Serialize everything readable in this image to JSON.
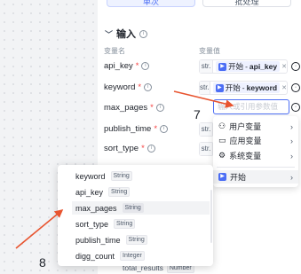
{
  "tabs": [
    {
      "label": "单次"
    },
    {
      "label": "批处理"
    }
  ],
  "section": {
    "title": "输入",
    "col_name": "变量名",
    "col_value": "变量值"
  },
  "rows": [
    {
      "name": "api_key",
      "required": "*",
      "type": "str.",
      "ref_prefix": "开始",
      "ref_var": "api_key"
    },
    {
      "name": "keyword",
      "required": "*",
      "type": "str.",
      "ref_prefix": "开始",
      "ref_var": "keyword"
    },
    {
      "name": "max_pages",
      "required": "*",
      "placeholder": "输入或引用参数值"
    },
    {
      "name": "publish_time",
      "required": "*",
      "type": "str."
    },
    {
      "name": "sort_type",
      "required": "*",
      "type": "str."
    }
  ],
  "ref_separator": "-",
  "dropdown": {
    "items": [
      {
        "label": "用户变量"
      },
      {
        "label": "应用变量"
      },
      {
        "label": "系统变量"
      },
      {
        "label": "开始"
      }
    ]
  },
  "variables": [
    {
      "name": "keyword",
      "type": "String"
    },
    {
      "name": "api_key",
      "type": "String"
    },
    {
      "name": "max_pages",
      "type": "String"
    },
    {
      "name": "sort_type",
      "type": "String"
    },
    {
      "name": "publish_time",
      "type": "String"
    },
    {
      "name": "digg_count",
      "type": "Integer"
    }
  ],
  "under_row": {
    "name": "total_results",
    "type": "Number"
  },
  "annotations": {
    "step7": "7",
    "step8": "8",
    "arrow_color": "#e8542f"
  },
  "colors": {
    "accent": "#4c6ef5",
    "required": "#f53f3f"
  }
}
